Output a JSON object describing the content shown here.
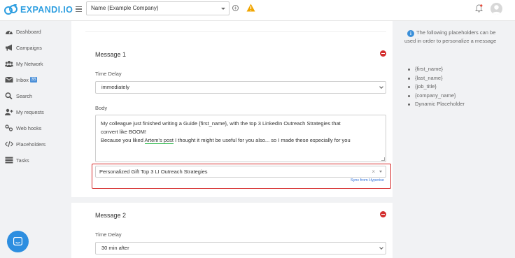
{
  "app": {
    "brand": "EXPANDI.IO",
    "company_select": "Name (Example Company)"
  },
  "sidebar": {
    "items": [
      {
        "label": "Dashboard",
        "icon": "dashboard-icon"
      },
      {
        "label": "Campaigns",
        "icon": "megaphone-icon"
      },
      {
        "label": "My Network",
        "icon": "users-icon"
      },
      {
        "label": "Inbox",
        "icon": "envelope-icon",
        "badge": "35"
      },
      {
        "label": "Search",
        "icon": "search-icon"
      },
      {
        "label": "My requests",
        "icon": "user-plus-icon"
      },
      {
        "label": "Web hooks",
        "icon": "webhook-icon"
      },
      {
        "label": "Placeholders",
        "icon": "code-icon"
      },
      {
        "label": "Tasks",
        "icon": "tasks-icon"
      }
    ]
  },
  "messages": [
    {
      "title": "Message 1",
      "time_delay_label": "Time Delay",
      "time_delay_value": "immediately",
      "body_label": "Body",
      "body_line1": "My colleague just finished writing a Guide {first_name},  with the top 3 LinkedIn Outreach Strategies that",
      "body_line2": "convert like BOOM!",
      "body_line3_pre": "Because you liked ",
      "body_line3_link": "Artem's post",
      "body_line3_post": " I thought it might be useful for you also... so I made these especially for you",
      "template_value": "Personalized Gift Top 3 LI Outreach Strategies",
      "clear_symbol": "×",
      "sync_link": "Sync from Hyperise"
    },
    {
      "title": "Message 2",
      "time_delay_label": "Time Delay",
      "time_delay_value": "30 min after"
    }
  ],
  "help": {
    "intro": "The following placeholders can be used in order to personalize a message",
    "placeholders": [
      "{first_name}",
      "{last_name}",
      "{job_title}",
      "{company_name}",
      "Dynamic Placeholder"
    ]
  },
  "colors": {
    "brand": "#2d9ee0",
    "highlight_frame": "#d62d2d",
    "remove": "#d32f2f",
    "link_underline": "#2db84b"
  }
}
